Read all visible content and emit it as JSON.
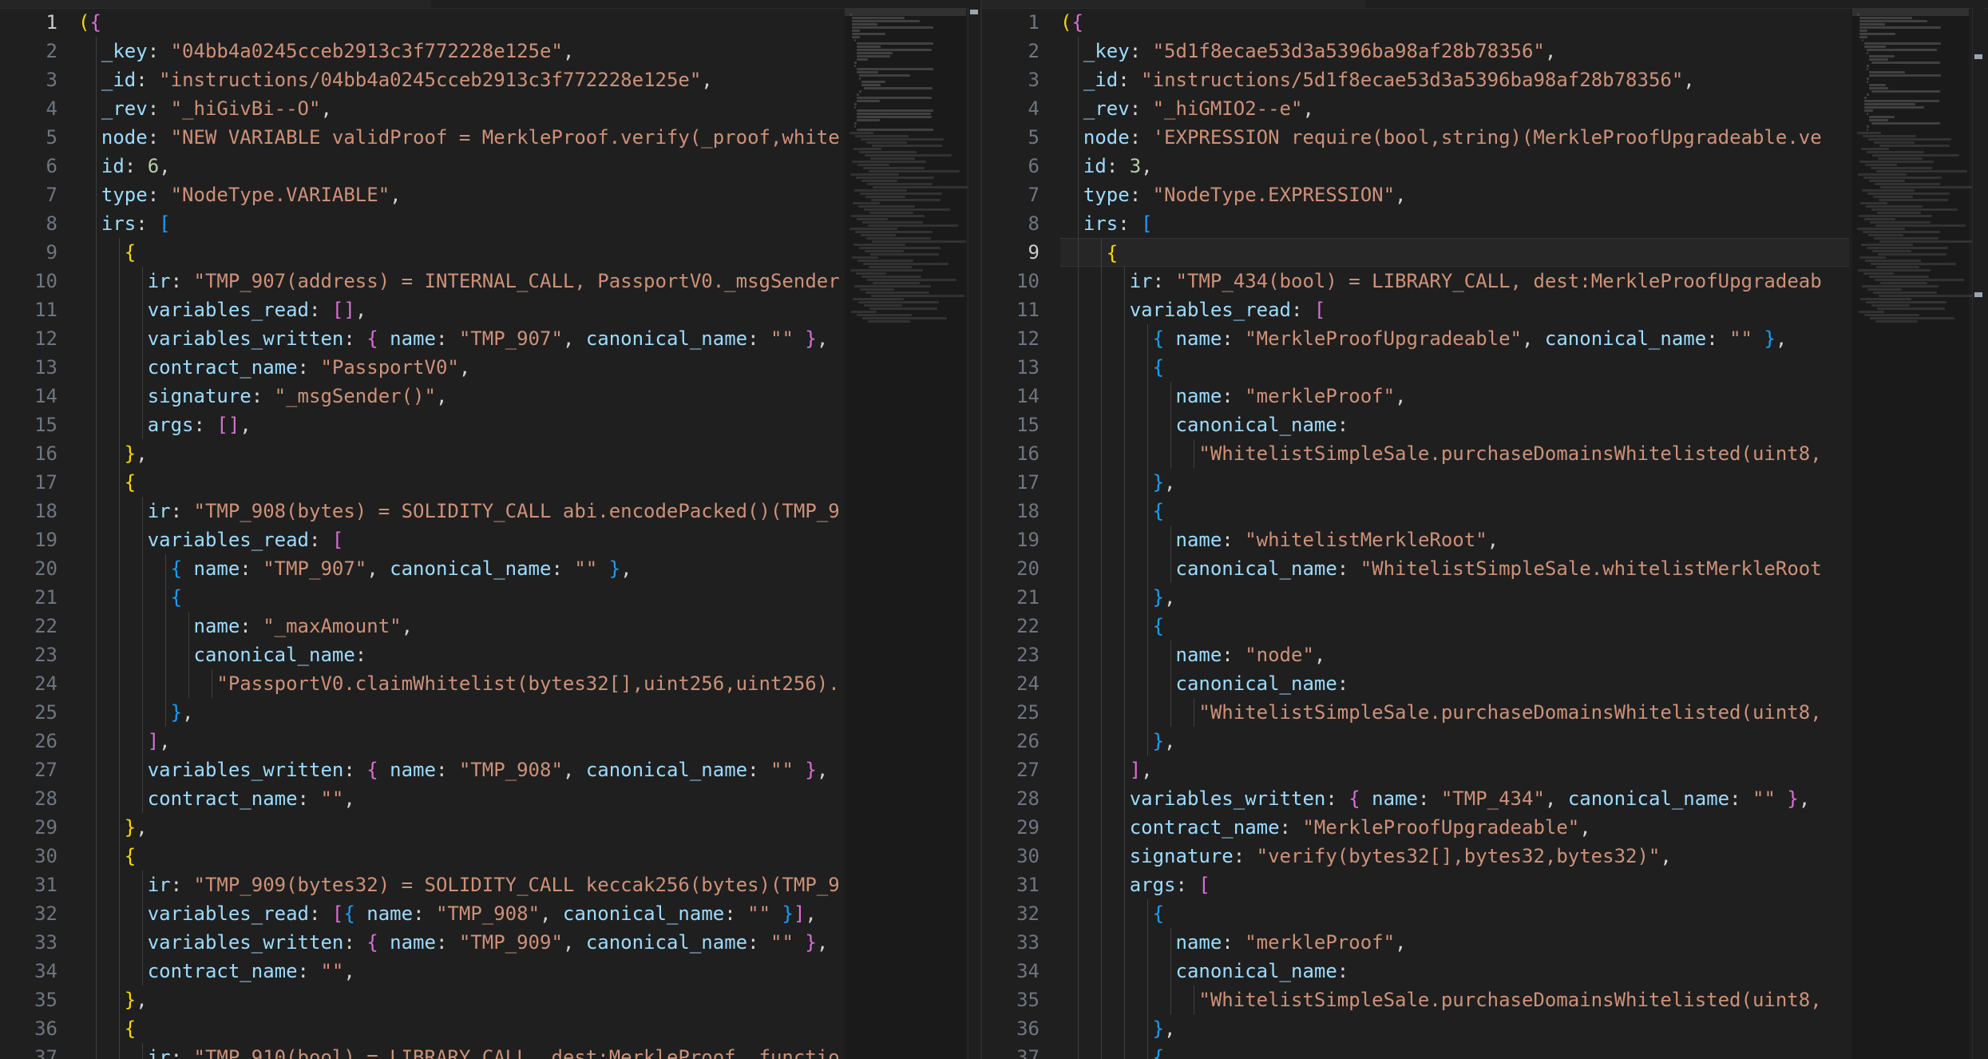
{
  "colors": {
    "background": "#1f1f1f",
    "key": "#9cdcfe",
    "string": "#ce9178",
    "number": "#b5cea8",
    "punctuation": "#d4d4d4",
    "bracket_level1": "#ffd700",
    "bracket_level2": "#da70d6",
    "bracket_level3": "#179fff",
    "line_number": "#6e7681"
  },
  "left_editor": {
    "current_line": 1,
    "lines": [
      [
        {
          "t": "b1",
          "v": "("
        },
        {
          "t": "b2",
          "v": "{"
        }
      ],
      [
        {
          "t": "k",
          "v": "_key"
        },
        {
          "t": "p",
          "v": ": "
        },
        {
          "t": "s",
          "v": "\"04bb4a0245cceb2913c3f772228e125e\""
        },
        {
          "t": "p",
          "v": ","
        }
      ],
      [
        {
          "t": "k",
          "v": "_id"
        },
        {
          "t": "p",
          "v": ": "
        },
        {
          "t": "s",
          "v": "\"instructions/04bb4a0245cceb2913c3f772228e125e\""
        },
        {
          "t": "p",
          "v": ","
        }
      ],
      [
        {
          "t": "k",
          "v": "_rev"
        },
        {
          "t": "p",
          "v": ": "
        },
        {
          "t": "s",
          "v": "\"_hiGivBi--O\""
        },
        {
          "t": "p",
          "v": ","
        }
      ],
      [
        {
          "t": "k",
          "v": "node"
        },
        {
          "t": "p",
          "v": ": "
        },
        {
          "t": "s",
          "v": "\"NEW VARIABLE validProof = MerkleProof.verify(_proof,white"
        }
      ],
      [
        {
          "t": "k",
          "v": "id"
        },
        {
          "t": "p",
          "v": ": "
        },
        {
          "t": "n",
          "v": "6"
        },
        {
          "t": "p",
          "v": ","
        }
      ],
      [
        {
          "t": "k",
          "v": "type"
        },
        {
          "t": "p",
          "v": ": "
        },
        {
          "t": "s",
          "v": "\"NodeType.VARIABLE\""
        },
        {
          "t": "p",
          "v": ","
        }
      ],
      [
        {
          "t": "k",
          "v": "irs"
        },
        {
          "t": "p",
          "v": ": "
        },
        {
          "t": "b3",
          "v": "["
        }
      ],
      [
        {
          "t": "b1",
          "v": "{"
        }
      ],
      [
        {
          "t": "k",
          "v": "ir"
        },
        {
          "t": "p",
          "v": ": "
        },
        {
          "t": "s",
          "v": "\"TMP_907(address) = INTERNAL_CALL, PassportV0._msgSender"
        }
      ],
      [
        {
          "t": "k",
          "v": "variables_read"
        },
        {
          "t": "p",
          "v": ": "
        },
        {
          "t": "b2",
          "v": "[]"
        },
        {
          "t": "p",
          "v": ","
        }
      ],
      [
        {
          "t": "k",
          "v": "variables_written"
        },
        {
          "t": "p",
          "v": ": "
        },
        {
          "t": "b2",
          "v": "{"
        },
        {
          "t": "p",
          "v": " "
        },
        {
          "t": "k",
          "v": "name"
        },
        {
          "t": "p",
          "v": ": "
        },
        {
          "t": "s",
          "v": "\"TMP_907\""
        },
        {
          "t": "p",
          "v": ", "
        },
        {
          "t": "k",
          "v": "canonical_name"
        },
        {
          "t": "p",
          "v": ": "
        },
        {
          "t": "s",
          "v": "\"\""
        },
        {
          "t": "p",
          "v": " "
        },
        {
          "t": "b2",
          "v": "}"
        },
        {
          "t": "p",
          "v": ","
        }
      ],
      [
        {
          "t": "k",
          "v": "contract_name"
        },
        {
          "t": "p",
          "v": ": "
        },
        {
          "t": "s",
          "v": "\"PassportV0\""
        },
        {
          "t": "p",
          "v": ","
        }
      ],
      [
        {
          "t": "k",
          "v": "signature"
        },
        {
          "t": "p",
          "v": ": "
        },
        {
          "t": "s",
          "v": "\"_msgSender()\""
        },
        {
          "t": "p",
          "v": ","
        }
      ],
      [
        {
          "t": "k",
          "v": "args"
        },
        {
          "t": "p",
          "v": ": "
        },
        {
          "t": "b2",
          "v": "[]"
        },
        {
          "t": "p",
          "v": ","
        }
      ],
      [
        {
          "t": "b1",
          "v": "}"
        },
        {
          "t": "p",
          "v": ","
        }
      ],
      [
        {
          "t": "b1",
          "v": "{"
        }
      ],
      [
        {
          "t": "k",
          "v": "ir"
        },
        {
          "t": "p",
          "v": ": "
        },
        {
          "t": "s",
          "v": "\"TMP_908(bytes) = SOLIDITY_CALL abi.encodePacked()(TMP_9"
        }
      ],
      [
        {
          "t": "k",
          "v": "variables_read"
        },
        {
          "t": "p",
          "v": ": "
        },
        {
          "t": "b2",
          "v": "["
        }
      ],
      [
        {
          "t": "b3",
          "v": "{"
        },
        {
          "t": "p",
          "v": " "
        },
        {
          "t": "k",
          "v": "name"
        },
        {
          "t": "p",
          "v": ": "
        },
        {
          "t": "s",
          "v": "\"TMP_907\""
        },
        {
          "t": "p",
          "v": ", "
        },
        {
          "t": "k",
          "v": "canonical_name"
        },
        {
          "t": "p",
          "v": ": "
        },
        {
          "t": "s",
          "v": "\"\""
        },
        {
          "t": "p",
          "v": " "
        },
        {
          "t": "b3",
          "v": "}"
        },
        {
          "t": "p",
          "v": ","
        }
      ],
      [
        {
          "t": "b3",
          "v": "{"
        }
      ],
      [
        {
          "t": "k",
          "v": "name"
        },
        {
          "t": "p",
          "v": ": "
        },
        {
          "t": "s",
          "v": "\"_maxAmount\""
        },
        {
          "t": "p",
          "v": ","
        }
      ],
      [
        {
          "t": "k",
          "v": "canonical_name"
        },
        {
          "t": "p",
          "v": ":"
        }
      ],
      [
        {
          "t": "s",
          "v": "\"PassportV0.claimWhitelist(bytes32[],uint256,uint256)."
        }
      ],
      [
        {
          "t": "b3",
          "v": "}"
        },
        {
          "t": "p",
          "v": ","
        }
      ],
      [
        {
          "t": "b2",
          "v": "]"
        },
        {
          "t": "p",
          "v": ","
        }
      ],
      [
        {
          "t": "k",
          "v": "variables_written"
        },
        {
          "t": "p",
          "v": ": "
        },
        {
          "t": "b2",
          "v": "{"
        },
        {
          "t": "p",
          "v": " "
        },
        {
          "t": "k",
          "v": "name"
        },
        {
          "t": "p",
          "v": ": "
        },
        {
          "t": "s",
          "v": "\"TMP_908\""
        },
        {
          "t": "p",
          "v": ", "
        },
        {
          "t": "k",
          "v": "canonical_name"
        },
        {
          "t": "p",
          "v": ": "
        },
        {
          "t": "s",
          "v": "\"\""
        },
        {
          "t": "p",
          "v": " "
        },
        {
          "t": "b2",
          "v": "}"
        },
        {
          "t": "p",
          "v": ","
        }
      ],
      [
        {
          "t": "k",
          "v": "contract_name"
        },
        {
          "t": "p",
          "v": ": "
        },
        {
          "t": "s",
          "v": "\"\""
        },
        {
          "t": "p",
          "v": ","
        }
      ],
      [
        {
          "t": "b1",
          "v": "}"
        },
        {
          "t": "p",
          "v": ","
        }
      ],
      [
        {
          "t": "b1",
          "v": "{"
        }
      ],
      [
        {
          "t": "k",
          "v": "ir"
        },
        {
          "t": "p",
          "v": ": "
        },
        {
          "t": "s",
          "v": "\"TMP_909(bytes32) = SOLIDITY_CALL keccak256(bytes)(TMP_9"
        }
      ],
      [
        {
          "t": "k",
          "v": "variables_read"
        },
        {
          "t": "p",
          "v": ": "
        },
        {
          "t": "b2",
          "v": "["
        },
        {
          "t": "b3",
          "v": "{"
        },
        {
          "t": "p",
          "v": " "
        },
        {
          "t": "k",
          "v": "name"
        },
        {
          "t": "p",
          "v": ": "
        },
        {
          "t": "s",
          "v": "\"TMP_908\""
        },
        {
          "t": "p",
          "v": ", "
        },
        {
          "t": "k",
          "v": "canonical_name"
        },
        {
          "t": "p",
          "v": ": "
        },
        {
          "t": "s",
          "v": "\"\""
        },
        {
          "t": "p",
          "v": " "
        },
        {
          "t": "b3",
          "v": "}"
        },
        {
          "t": "b2",
          "v": "]"
        },
        {
          "t": "p",
          "v": ","
        }
      ],
      [
        {
          "t": "k",
          "v": "variables_written"
        },
        {
          "t": "p",
          "v": ": "
        },
        {
          "t": "b2",
          "v": "{"
        },
        {
          "t": "p",
          "v": " "
        },
        {
          "t": "k",
          "v": "name"
        },
        {
          "t": "p",
          "v": ": "
        },
        {
          "t": "s",
          "v": "\"TMP_909\""
        },
        {
          "t": "p",
          "v": ", "
        },
        {
          "t": "k",
          "v": "canonical_name"
        },
        {
          "t": "p",
          "v": ": "
        },
        {
          "t": "s",
          "v": "\"\""
        },
        {
          "t": "p",
          "v": " "
        },
        {
          "t": "b2",
          "v": "}"
        },
        {
          "t": "p",
          "v": ","
        }
      ],
      [
        {
          "t": "k",
          "v": "contract_name"
        },
        {
          "t": "p",
          "v": ": "
        },
        {
          "t": "s",
          "v": "\"\""
        },
        {
          "t": "p",
          "v": ","
        }
      ],
      [
        {
          "t": "b1",
          "v": "}"
        },
        {
          "t": "p",
          "v": ","
        }
      ],
      [
        {
          "t": "b1",
          "v": "{"
        }
      ],
      [
        {
          "t": "k",
          "v": "ir"
        },
        {
          "t": "p",
          "v": ": "
        },
        {
          "t": "s",
          "v": "\"TMP_910(bool) = LIBRARY_CALL, dest:MerkleProof, functio"
        }
      ]
    ]
  },
  "right_editor": {
    "current_line": 9,
    "lines": [
      [
        {
          "t": "b1",
          "v": "("
        },
        {
          "t": "b2",
          "v": "{"
        }
      ],
      [
        {
          "t": "k",
          "v": "_key"
        },
        {
          "t": "p",
          "v": ": "
        },
        {
          "t": "s",
          "v": "\"5d1f8ecae53d3a5396ba98af28b78356\""
        },
        {
          "t": "p",
          "v": ","
        }
      ],
      [
        {
          "t": "k",
          "v": "_id"
        },
        {
          "t": "p",
          "v": ": "
        },
        {
          "t": "s",
          "v": "\"instructions/5d1f8ecae53d3a5396ba98af28b78356\""
        },
        {
          "t": "p",
          "v": ","
        }
      ],
      [
        {
          "t": "k",
          "v": "_rev"
        },
        {
          "t": "p",
          "v": ": "
        },
        {
          "t": "s",
          "v": "\"_hiGMIO2--e\""
        },
        {
          "t": "p",
          "v": ","
        }
      ],
      [
        {
          "t": "k",
          "v": "node"
        },
        {
          "t": "p",
          "v": ": "
        },
        {
          "t": "s",
          "v": "'EXPRESSION require(bool,string)(MerkleProofUpgradeable.ve"
        }
      ],
      [
        {
          "t": "k",
          "v": "id"
        },
        {
          "t": "p",
          "v": ": "
        },
        {
          "t": "n",
          "v": "3"
        },
        {
          "t": "p",
          "v": ","
        }
      ],
      [
        {
          "t": "k",
          "v": "type"
        },
        {
          "t": "p",
          "v": ": "
        },
        {
          "t": "s",
          "v": "\"NodeType.EXPRESSION\""
        },
        {
          "t": "p",
          "v": ","
        }
      ],
      [
        {
          "t": "k",
          "v": "irs"
        },
        {
          "t": "p",
          "v": ": "
        },
        {
          "t": "b3",
          "v": "["
        }
      ],
      [
        {
          "t": "b1",
          "v": "{"
        }
      ],
      [
        {
          "t": "k",
          "v": "ir"
        },
        {
          "t": "p",
          "v": ": "
        },
        {
          "t": "s",
          "v": "\"TMP_434(bool) = LIBRARY_CALL, dest:MerkleProofUpgradeab"
        }
      ],
      [
        {
          "t": "k",
          "v": "variables_read"
        },
        {
          "t": "p",
          "v": ": "
        },
        {
          "t": "b2",
          "v": "["
        }
      ],
      [
        {
          "t": "b3",
          "v": "{"
        },
        {
          "t": "p",
          "v": " "
        },
        {
          "t": "k",
          "v": "name"
        },
        {
          "t": "p",
          "v": ": "
        },
        {
          "t": "s",
          "v": "\"MerkleProofUpgradeable\""
        },
        {
          "t": "p",
          "v": ", "
        },
        {
          "t": "k",
          "v": "canonical_name"
        },
        {
          "t": "p",
          "v": ": "
        },
        {
          "t": "s",
          "v": "\"\""
        },
        {
          "t": "p",
          "v": " "
        },
        {
          "t": "b3",
          "v": "}"
        },
        {
          "t": "p",
          "v": ","
        }
      ],
      [
        {
          "t": "b3",
          "v": "{"
        }
      ],
      [
        {
          "t": "k",
          "v": "name"
        },
        {
          "t": "p",
          "v": ": "
        },
        {
          "t": "s",
          "v": "\"merkleProof\""
        },
        {
          "t": "p",
          "v": ","
        }
      ],
      [
        {
          "t": "k",
          "v": "canonical_name"
        },
        {
          "t": "p",
          "v": ":"
        }
      ],
      [
        {
          "t": "s",
          "v": "\"WhitelistSimpleSale.purchaseDomainsWhitelisted(uint8,"
        }
      ],
      [
        {
          "t": "b3",
          "v": "}"
        },
        {
          "t": "p",
          "v": ","
        }
      ],
      [
        {
          "t": "b3",
          "v": "{"
        }
      ],
      [
        {
          "t": "k",
          "v": "name"
        },
        {
          "t": "p",
          "v": ": "
        },
        {
          "t": "s",
          "v": "\"whitelistMerkleRoot\""
        },
        {
          "t": "p",
          "v": ","
        }
      ],
      [
        {
          "t": "k",
          "v": "canonical_name"
        },
        {
          "t": "p",
          "v": ": "
        },
        {
          "t": "s",
          "v": "\"WhitelistSimpleSale.whitelistMerkleRoot"
        }
      ],
      [
        {
          "t": "b3",
          "v": "}"
        },
        {
          "t": "p",
          "v": ","
        }
      ],
      [
        {
          "t": "b3",
          "v": "{"
        }
      ],
      [
        {
          "t": "k",
          "v": "name"
        },
        {
          "t": "p",
          "v": ": "
        },
        {
          "t": "s",
          "v": "\"node\""
        },
        {
          "t": "p",
          "v": ","
        }
      ],
      [
        {
          "t": "k",
          "v": "canonical_name"
        },
        {
          "t": "p",
          "v": ":"
        }
      ],
      [
        {
          "t": "s",
          "v": "\"WhitelistSimpleSale.purchaseDomainsWhitelisted(uint8,"
        }
      ],
      [
        {
          "t": "b3",
          "v": "}"
        },
        {
          "t": "p",
          "v": ","
        }
      ],
      [
        {
          "t": "b2",
          "v": "]"
        },
        {
          "t": "p",
          "v": ","
        }
      ],
      [
        {
          "t": "k",
          "v": "variables_written"
        },
        {
          "t": "p",
          "v": ": "
        },
        {
          "t": "b2",
          "v": "{"
        },
        {
          "t": "p",
          "v": " "
        },
        {
          "t": "k",
          "v": "name"
        },
        {
          "t": "p",
          "v": ": "
        },
        {
          "t": "s",
          "v": "\"TMP_434\""
        },
        {
          "t": "p",
          "v": ", "
        },
        {
          "t": "k",
          "v": "canonical_name"
        },
        {
          "t": "p",
          "v": ": "
        },
        {
          "t": "s",
          "v": "\"\""
        },
        {
          "t": "p",
          "v": " "
        },
        {
          "t": "b2",
          "v": "}"
        },
        {
          "t": "p",
          "v": ","
        }
      ],
      [
        {
          "t": "k",
          "v": "contract_name"
        },
        {
          "t": "p",
          "v": ": "
        },
        {
          "t": "s",
          "v": "\"MerkleProofUpgradeable\""
        },
        {
          "t": "p",
          "v": ","
        }
      ],
      [
        {
          "t": "k",
          "v": "signature"
        },
        {
          "t": "p",
          "v": ": "
        },
        {
          "t": "s",
          "v": "\"verify(bytes32[],bytes32,bytes32)\""
        },
        {
          "t": "p",
          "v": ","
        }
      ],
      [
        {
          "t": "k",
          "v": "args"
        },
        {
          "t": "p",
          "v": ": "
        },
        {
          "t": "b2",
          "v": "["
        }
      ],
      [
        {
          "t": "b3",
          "v": "{"
        }
      ],
      [
        {
          "t": "k",
          "v": "name"
        },
        {
          "t": "p",
          "v": ": "
        },
        {
          "t": "s",
          "v": "\"merkleProof\""
        },
        {
          "t": "p",
          "v": ","
        }
      ],
      [
        {
          "t": "k",
          "v": "canonical_name"
        },
        {
          "t": "p",
          "v": ":"
        }
      ],
      [
        {
          "t": "s",
          "v": "\"WhitelistSimpleSale.purchaseDomainsWhitelisted(uint8,"
        }
      ],
      [
        {
          "t": "b3",
          "v": "}"
        },
        {
          "t": "p",
          "v": ","
        }
      ],
      [
        {
          "t": "b3",
          "v": "{"
        }
      ]
    ]
  }
}
